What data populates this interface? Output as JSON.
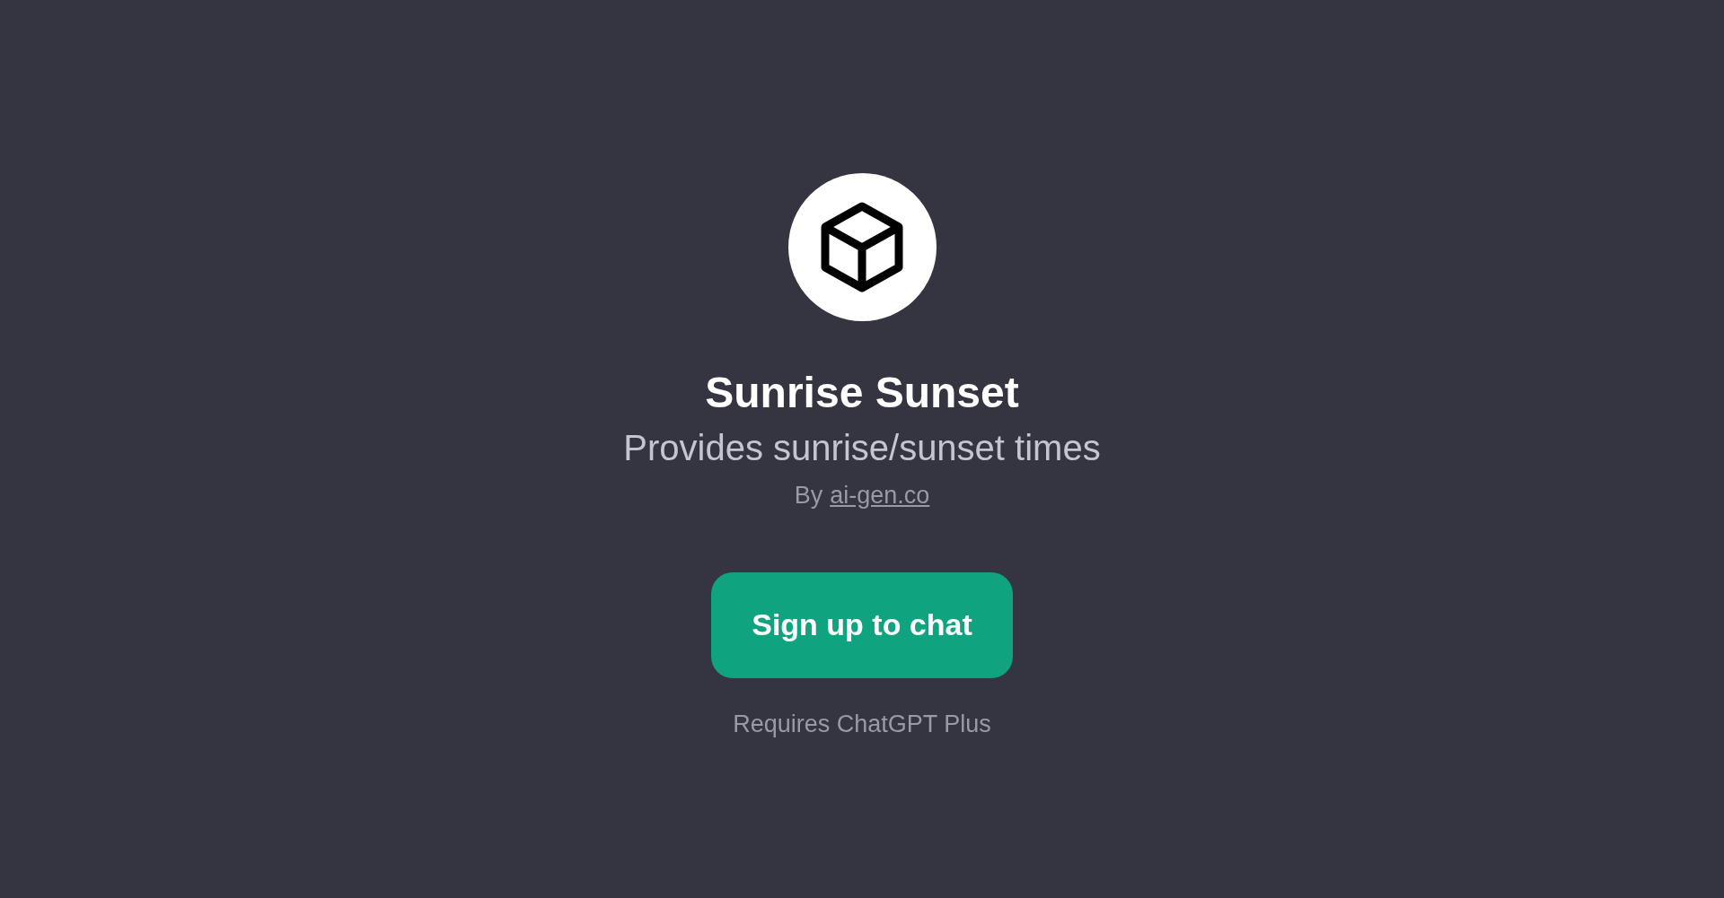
{
  "gizmo": {
    "name": "Sunrise Sunset",
    "description": "Provides sunrise/sunset times",
    "by_prefix": "By",
    "author_link": "ai-gen.co"
  },
  "signup_button": "Sign up to chat",
  "requirement": "Requires ChatGPT Plus"
}
